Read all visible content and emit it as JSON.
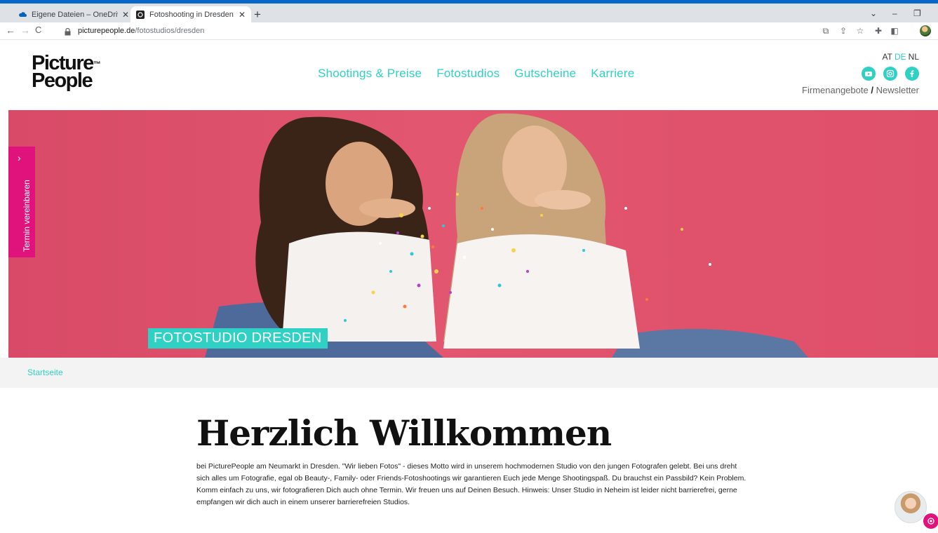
{
  "browser": {
    "tabs": [
      {
        "title": "Eigene Dateien – OneDrive",
        "icon": "onedrive-cloud-icon"
      },
      {
        "title": "Fotoshooting in Dresden: Neuma",
        "icon": "picturepeople-favicon",
        "active": true
      }
    ],
    "url_host": "picturepeople.de",
    "url_path": "/fotostudios/dresden"
  },
  "site": {
    "logo_line1": "Picture",
    "logo_tm": "™",
    "logo_line2": "People",
    "nav": [
      "Shootings & Preise",
      "Fotostudios",
      "Gutscheine",
      "Karriere"
    ],
    "languages": [
      {
        "code": "AT",
        "active": false
      },
      {
        "code": "DE",
        "active": true
      },
      {
        "code": "NL",
        "active": false
      }
    ],
    "social_icons": [
      "youtube-icon",
      "instagram-icon",
      "facebook-icon"
    ],
    "header_links": {
      "company": "Firmenangebote",
      "separator": "/",
      "newsletter": "Newsletter"
    },
    "accent_color": "#2ed1c4",
    "pink_color": "#e0137c"
  },
  "hero": {
    "title": "FOTOSTUDIO DRESDEN",
    "termin_label": "Termin vereinbaren"
  },
  "breadcrumb": {
    "home": "Startseite"
  },
  "content": {
    "heading": "Herzlich Willkommen",
    "intro": "bei PicturePeople am Neumarkt in Dresden. \"Wir lieben Fotos\" - dieses Motto wird in unserem hochmodernen Studio von den jungen Fotografen gelebt. Bei uns dreht sich alles um Fotografie, egal ob Beauty-, Family- oder Friends-Fotoshootings wir garantieren Euch jede Menge Shootingspaß. Du brauchst ein Passbild? Kein Problem. Komm einfach zu uns, wir fotografieren Dich auch ohne Termin. Wir freuen uns auf Deinen Besuch. Hinweis: Unser Studio in Neheim ist leider nicht barrierefrei, gerne empfangen wir dich auch in einem unserer barrierefreien Studios."
  }
}
